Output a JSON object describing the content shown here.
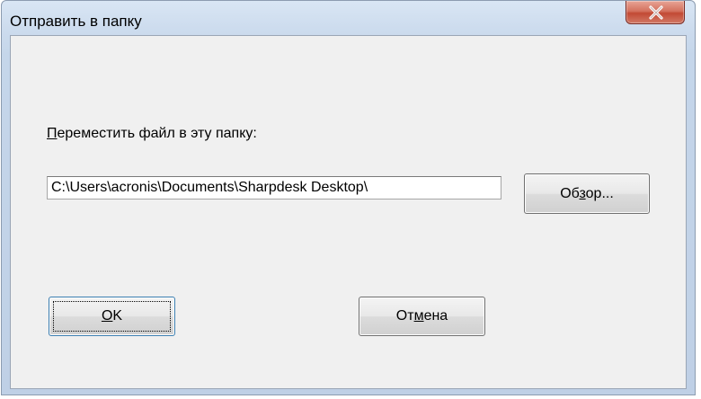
{
  "window": {
    "title": "Отправить в папку",
    "close_label": "x"
  },
  "form": {
    "label_mnemonic": "П",
    "label_rest": "ереместить файл в эту папку:",
    "path_value": "C:\\Users\\acronis\\Documents\\Sharpdesk Desktop\\"
  },
  "buttons": {
    "browse_pre": "Об",
    "browse_mnemonic": "з",
    "browse_post": "ор...",
    "ok_mnemonic": "O",
    "ok_post": "K",
    "cancel_pre": "От",
    "cancel_mnemonic": "м",
    "cancel_post": "ена"
  }
}
